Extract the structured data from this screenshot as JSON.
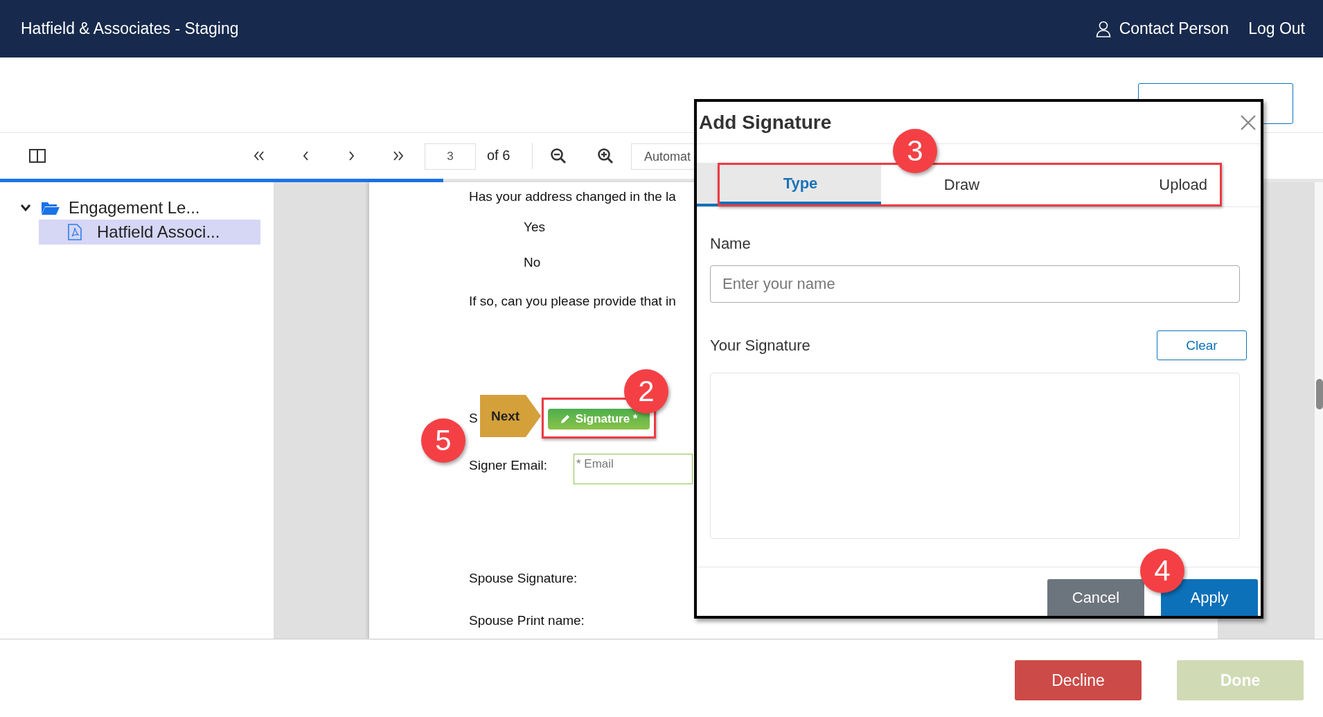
{
  "header": {
    "title": "Hatfield & Associates - Staging",
    "user": "Contact Person",
    "logout": "Log Out"
  },
  "toolbar": {
    "page": "3",
    "page_count": "of 6",
    "zoom_select": "Automat"
  },
  "loading_bar": {
    "level": 0.335
  },
  "sidebar": {
    "tree": [
      {
        "label": "Engagement Le...",
        "expanded": true,
        "children": [
          {
            "label": "Hatfield Associ...",
            "selected": true
          }
        ]
      }
    ]
  },
  "document": {
    "question": "Has your address changed in the la",
    "options": [
      "Yes",
      "No"
    ],
    "followup": "If so, can you please provide that in",
    "signer_signature_label": "S",
    "next_tag": "Next",
    "signature_button": "Signature *",
    "signer_email_label": "Signer Email:",
    "email_placeholder": "* Email",
    "spouse_signature_label": "Spouse Signature:",
    "spouse_print_label": "Spouse Print name:"
  },
  "dialog": {
    "title": "Add Signature",
    "tabs": [
      {
        "label": "Type",
        "selected": true
      },
      {
        "label": "Draw",
        "selected": false
      },
      {
        "label": "Upload",
        "selected": false
      }
    ],
    "name_label": "Name",
    "name_placeholder": "Enter your name",
    "signature_label": "Your Signature",
    "clear": "Clear",
    "cancel": "Cancel",
    "apply": "Apply"
  },
  "callouts": {
    "signature": "2",
    "tabs": "3",
    "apply": "4",
    "next": "5"
  },
  "footer": {
    "decline": "Decline",
    "done": {
      "label": "Done",
      "disabled": true
    }
  }
}
